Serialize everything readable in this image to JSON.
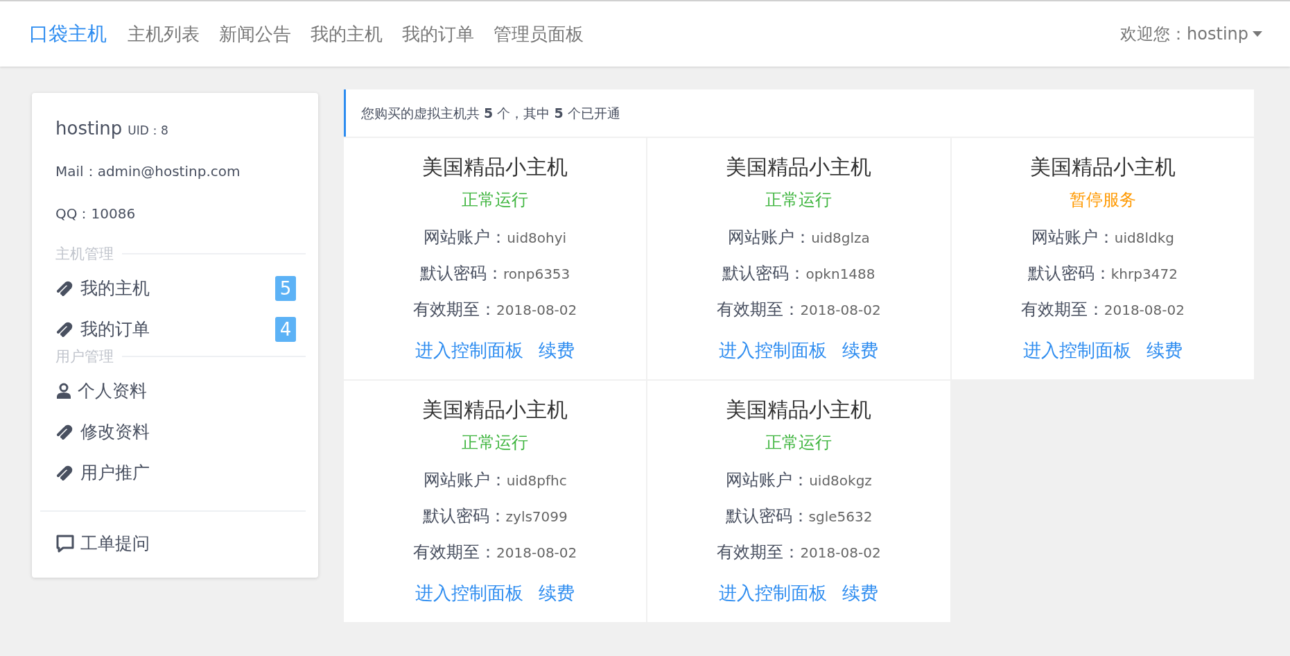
{
  "header": {
    "brand": "口袋主机",
    "nav": [
      "主机列表",
      "新闻公告",
      "我的主机",
      "我的订单",
      "管理员面板"
    ],
    "user_menu": "欢迎您：hostinp"
  },
  "sidebar": {
    "username": "hostinp",
    "uid": "UID：8",
    "mail": "Mail：admin@hostinp.com",
    "qq": "QQ：10086",
    "sections": [
      {
        "title": "主机管理",
        "items": [
          {
            "kind": "link",
            "label": "我的主机",
            "badge": "5"
          },
          {
            "kind": "link",
            "label": "我的订单",
            "badge": "4"
          }
        ]
      },
      {
        "title": "用户管理",
        "items": [
          {
            "kind": "user",
            "label": "个人资料"
          },
          {
            "kind": "link",
            "label": "修改资料"
          },
          {
            "kind": "link",
            "label": "用户推广"
          }
        ]
      }
    ],
    "footer_item": {
      "kind": "chat",
      "label": "工单提问"
    }
  },
  "notice": "您购买的虚拟主机共 **5** 个，其中 **5** 个已开通",
  "hosts": [
    {
      "name": "美国精品小主机",
      "status": "正常运行",
      "color": "#3fb53f",
      "account_label": "网站账户：",
      "account": "uid8ohyi",
      "password_label": "默认密码：",
      "password": "ronp6353",
      "expiry_label": "有效期至：",
      "expiry": "2018-08-02",
      "actions": [
        "进入控制面板",
        "续费"
      ]
    },
    {
      "name": "美国精品小主机",
      "status": "正常运行",
      "color": "#3fb53f",
      "account_label": "网站账户：",
      "account": "uid8glza",
      "password_label": "默认密码：",
      "password": "opkn1488",
      "expiry_label": "有效期至：",
      "expiry": "2018-08-02",
      "actions": [
        "进入控制面板",
        "续费"
      ]
    },
    {
      "name": "美国精品小主机",
      "status": "暂停服务",
      "color": "#ff9900",
      "account_label": "网站账户：",
      "account": "uid8ldkg",
      "password_label": "默认密码：",
      "password": "khrp3472",
      "expiry_label": "有效期至：",
      "expiry": "2018-08-02",
      "actions": [
        "进入控制面板",
        "续费"
      ]
    },
    {
      "name": "美国精品小主机",
      "status": "正常运行",
      "color": "#3fb53f",
      "account_label": "网站账户：",
      "account": "uid8pfhc",
      "password_label": "默认密码：",
      "password": "zyls7099",
      "expiry_label": "有效期至：",
      "expiry": "2018-08-02",
      "actions": [
        "进入控制面板",
        "续费"
      ]
    },
    {
      "name": "美国精品小主机",
      "status": "正常运行",
      "color": "#3fb53f",
      "account_label": "网站账户：",
      "account": "uid8okgz",
      "password_label": "默认密码：",
      "password": "sgle5632",
      "expiry_label": "有效期至：",
      "expiry": "2018-08-02",
      "actions": [
        "进入控制面板",
        "续费"
      ]
    }
  ]
}
